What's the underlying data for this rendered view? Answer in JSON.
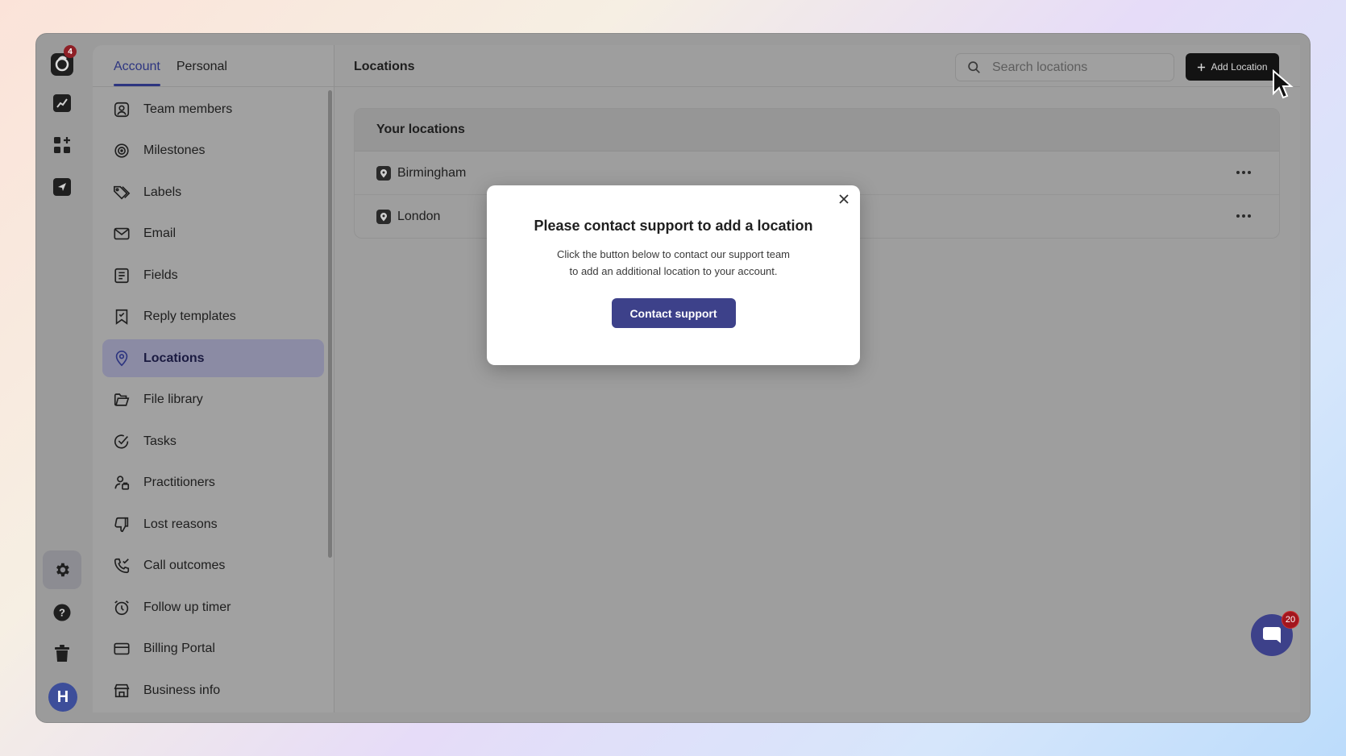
{
  "rail": {
    "logo_badge": "4",
    "avatar_letter": "H"
  },
  "settings": {
    "tabs": [
      {
        "label": "Account"
      },
      {
        "label": "Personal"
      }
    ],
    "nav": [
      {
        "label": "Team members",
        "icon": "user-square-icon"
      },
      {
        "label": "Milestones",
        "icon": "target-icon"
      },
      {
        "label": "Labels",
        "icon": "tags-icon"
      },
      {
        "label": "Email",
        "icon": "mail-icon"
      },
      {
        "label": "Fields",
        "icon": "form-icon"
      },
      {
        "label": "Reply templates",
        "icon": "bookmark-icon"
      },
      {
        "label": "Locations",
        "icon": "map-pin-icon"
      },
      {
        "label": "File library",
        "icon": "folder-icon"
      },
      {
        "label": "Tasks",
        "icon": "check-circle-icon"
      },
      {
        "label": "Practitioners",
        "icon": "user-badge-icon"
      },
      {
        "label": "Lost reasons",
        "icon": "thumbs-down-icon"
      },
      {
        "label": "Call outcomes",
        "icon": "phone-check-icon"
      },
      {
        "label": "Follow up timer",
        "icon": "alarm-icon"
      },
      {
        "label": "Billing Portal",
        "icon": "credit-card-icon"
      },
      {
        "label": "Business info",
        "icon": "store-icon"
      }
    ]
  },
  "main": {
    "title": "Locations",
    "search_placeholder": "Search locations",
    "add_label": "Add Location",
    "card_title": "Your locations",
    "locations": [
      {
        "name": "Birmingham"
      },
      {
        "name": "London"
      }
    ]
  },
  "modal": {
    "title": "Please contact support to add a location",
    "body_line1": "Click the button below to contact our support team",
    "body_line2": "to add an additional location to your account.",
    "button": "Contact support"
  },
  "chat": {
    "badge": "20"
  },
  "colors": {
    "accent": "#3d418a",
    "badge": "#a3151d"
  }
}
